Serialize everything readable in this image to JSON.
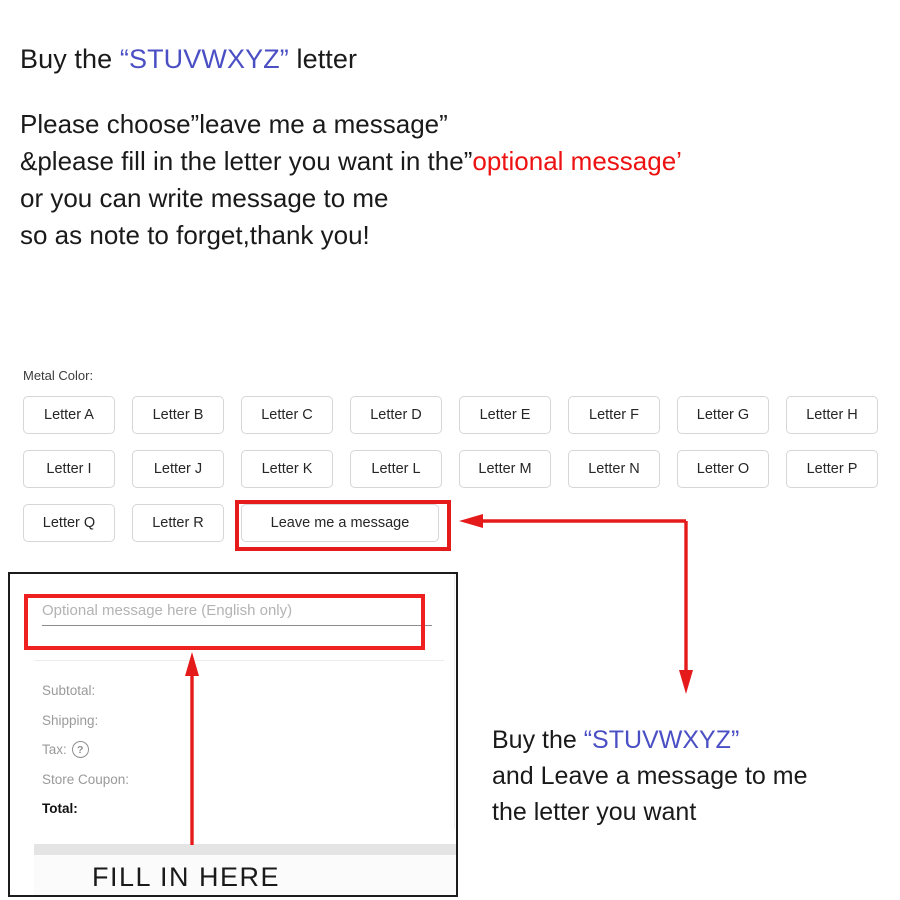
{
  "headline": {
    "before": "Buy the ",
    "quoted": "“STUVWXYZ”",
    "after": " letter"
  },
  "instructions": {
    "line1": "Please choose”leave me a message”",
    "line2_before": "&please fill in the letter you want in the”",
    "line2_highlight": "optional message",
    "line2_after": "’",
    "line3": "or you can write message to me",
    "line4": "so as note to forget,thank you!"
  },
  "variant": {
    "label": "Metal Color:",
    "options": [
      "Letter A",
      "Letter B",
      "Letter C",
      "Letter D",
      "Letter E",
      "Letter F",
      "Letter G",
      "Letter H",
      "Letter I",
      "Letter J",
      "Letter K",
      "Letter L",
      "Letter M",
      "Letter N",
      "Letter O",
      "Letter P",
      "Letter Q",
      "Letter R",
      "Leave me a message"
    ],
    "message_option": "Leave me a message"
  },
  "cart": {
    "message_placeholder": "Optional message here (English only)",
    "message_value": "",
    "totals": [
      {
        "label": "Subtotal:",
        "value": ""
      },
      {
        "label": "Shipping:",
        "value": ""
      },
      {
        "label": "Tax:",
        "value": "",
        "has_help_icon": true,
        "help_glyph": "?"
      },
      {
        "label": "Store Coupon:",
        "value": ""
      },
      {
        "label": "Total:",
        "value": "",
        "emphasis": true
      }
    ],
    "fill_note": "FILL  IN  HERE"
  },
  "caption": {
    "line1_before": "Buy the ",
    "line1_quoted": "“STUVWXYZ”",
    "line2": "and Leave a message to me",
    "line3": "the letter you want"
  },
  "colors": {
    "accent_blue": "#4b4fc4",
    "accent_red": "#ee1111",
    "annotation_red": "#e51b1b",
    "text": "#1a1a1a",
    "muted": "#9a9a9a",
    "border": "#d6d6d6"
  }
}
